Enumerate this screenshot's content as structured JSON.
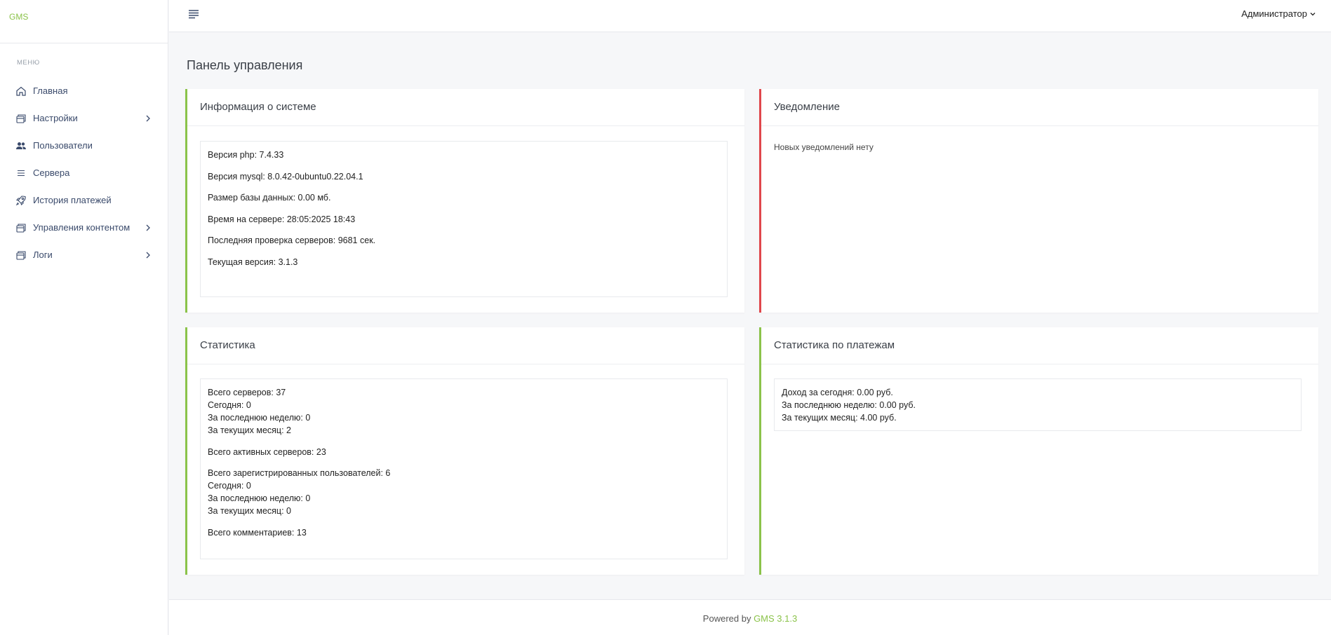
{
  "brand": {
    "name": "GMS"
  },
  "sidebar": {
    "caption": "МЕНЮ",
    "items": [
      {
        "label": "Главная",
        "icon": "home-icon"
      },
      {
        "label": "Настройки",
        "icon": "layers-icon",
        "has_submenu": true
      },
      {
        "label": "Пользователи",
        "icon": "users-icon"
      },
      {
        "label": "Сервера",
        "icon": "list-icon"
      },
      {
        "label": "История платежей",
        "icon": "rocket-icon"
      },
      {
        "label": "Управления контентом",
        "icon": "layers-icon",
        "has_submenu": true
      },
      {
        "label": "Логи",
        "icon": "layers-icon",
        "has_submenu": true
      }
    ]
  },
  "topbar": {
    "user_label": "Администратор"
  },
  "page": {
    "title": "Панель управления"
  },
  "system_info": {
    "title": "Информация о системе",
    "lines": [
      "Версия php: 7.4.33",
      "Версия mysql: 8.0.42-0ubuntu0.22.04.1",
      "Размер базы данных: 0.00 мб.",
      "Время на сервере: 28:05:2025 18:43",
      "Последняя проверка серверов: 9681 сек.",
      "Текущая версия: 3.1.3"
    ]
  },
  "notifications": {
    "title": "Уведомление",
    "text": "Новых уведомлений нету"
  },
  "statistics": {
    "title": "Статистика",
    "servers_total": "Всего серверов: 37",
    "servers_today": "Сегодня: 0",
    "servers_week": "За последнюю неделю: 0",
    "servers_month": "За текущих месяц: 2",
    "active_servers": "Всего активных серверов: 23",
    "users_total": "Всего зарегистрированных пользователей: 6",
    "users_today": "Сегодня: 0",
    "users_week": "За последнюю неделю: 0",
    "users_month": "За текущих месяц: 0",
    "comments_total": "Всего комментариев: 13"
  },
  "payments": {
    "title": "Статистика по платежам",
    "today": "Доход за сегодня: 0.00 руб.",
    "week": "За последнюю неделю: 0.00 руб.",
    "month": "За текущих месяц: 4.00 руб."
  },
  "footer": {
    "prefix": "Powered by ",
    "product": "GMS 3.1.3"
  },
  "colors": {
    "accent": "#8bc34a",
    "danger": "#e0474c",
    "nav_text": "#3a4a6b"
  }
}
